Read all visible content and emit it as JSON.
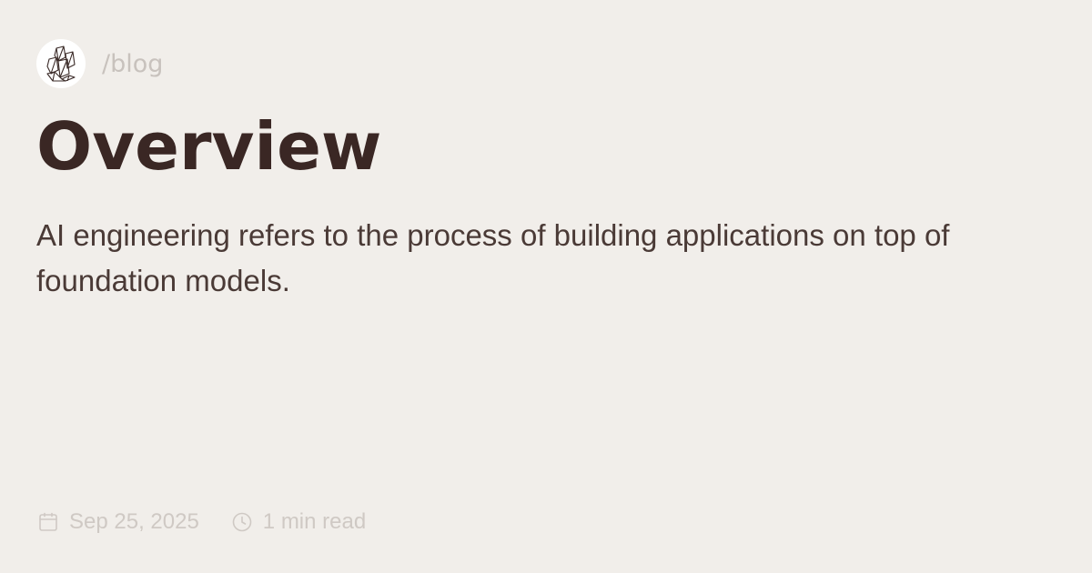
{
  "header": {
    "logo_icon": "crystal-logo-icon",
    "section_label": "/blog"
  },
  "post": {
    "title": "Overview",
    "description": "AI engineering refers to the process of building applications on top of foundation models."
  },
  "meta": {
    "date_icon": "calendar-icon",
    "date": "Sep 25, 2025",
    "read_icon": "clock-icon",
    "read_time": "1 min read"
  },
  "colors": {
    "background": "#f1eeea",
    "title": "#3a2724",
    "body_text": "#4a3a36",
    "muted_text": "#cfc9c4"
  }
}
